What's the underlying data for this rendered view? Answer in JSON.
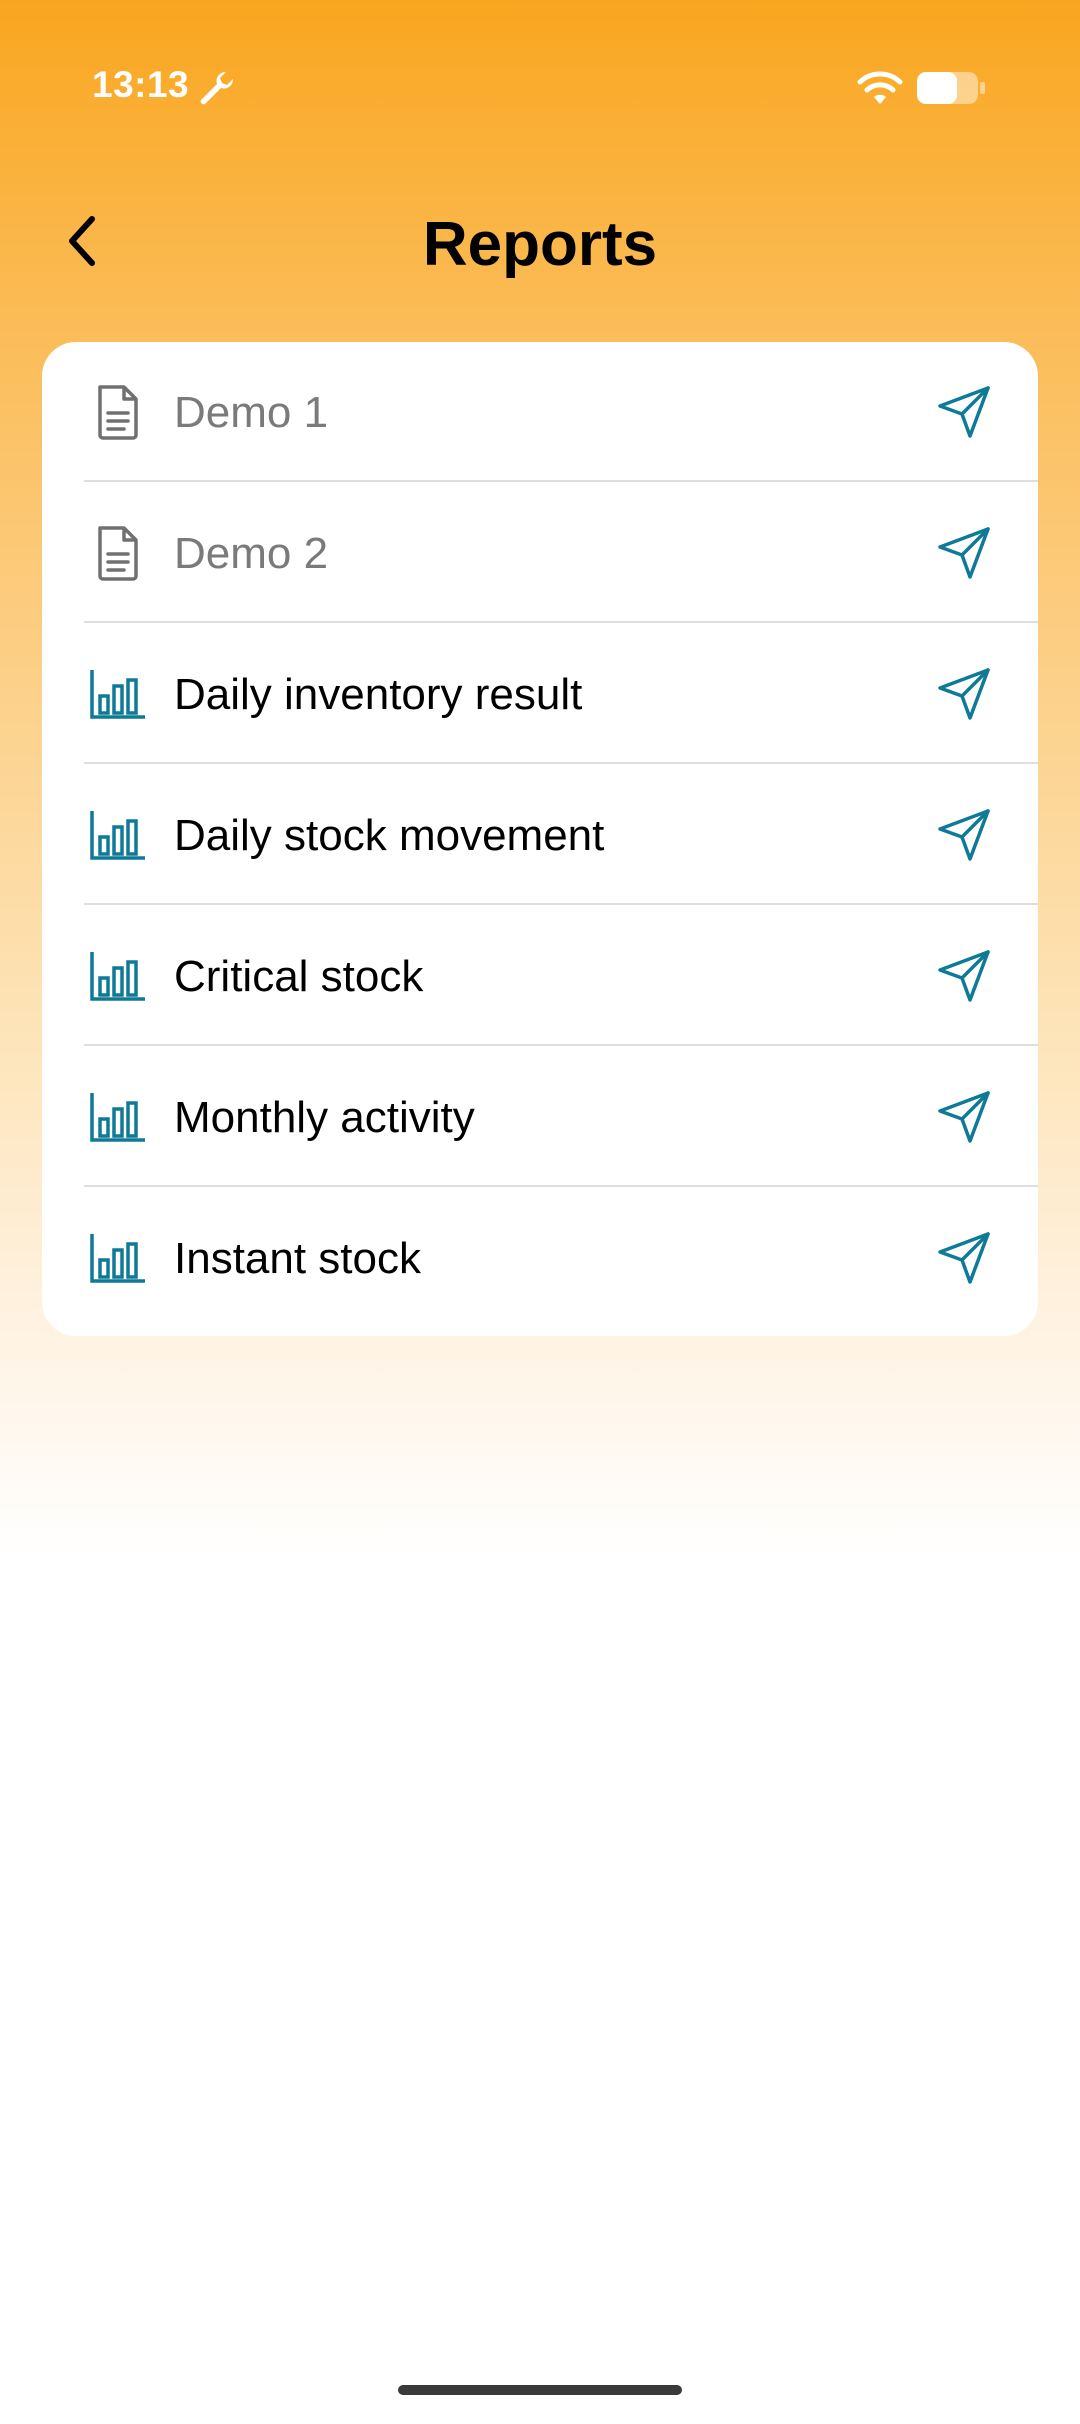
{
  "status_bar": {
    "time": "13:13",
    "icons": [
      "wrench-icon",
      "wifi-icon",
      "battery-icon"
    ]
  },
  "header": {
    "title": "Reports",
    "back_icon": "chevron-left-icon"
  },
  "colors": {
    "accent": "#0e7a97",
    "gradient_top": "#f9a61f",
    "demo_icon": "#707070",
    "demo_text": "#7a7a7a",
    "report_text": "#000000"
  },
  "reports": [
    {
      "label": "Demo 1",
      "kind": "demo",
      "icon": "document-icon",
      "action_icon": "send-icon"
    },
    {
      "label": "Demo 2",
      "kind": "demo",
      "icon": "document-icon",
      "action_icon": "send-icon"
    },
    {
      "label": "Daily inventory result",
      "kind": "report",
      "icon": "bar-chart-icon",
      "action_icon": "send-icon"
    },
    {
      "label": "Daily stock movement",
      "kind": "report",
      "icon": "bar-chart-icon",
      "action_icon": "send-icon"
    },
    {
      "label": "Critical stock",
      "kind": "report",
      "icon": "bar-chart-icon",
      "action_icon": "send-icon"
    },
    {
      "label": "Monthly activity",
      "kind": "report",
      "icon": "bar-chart-icon",
      "action_icon": "send-icon"
    },
    {
      "label": "Instant stock",
      "kind": "report",
      "icon": "bar-chart-icon",
      "action_icon": "send-icon"
    }
  ]
}
